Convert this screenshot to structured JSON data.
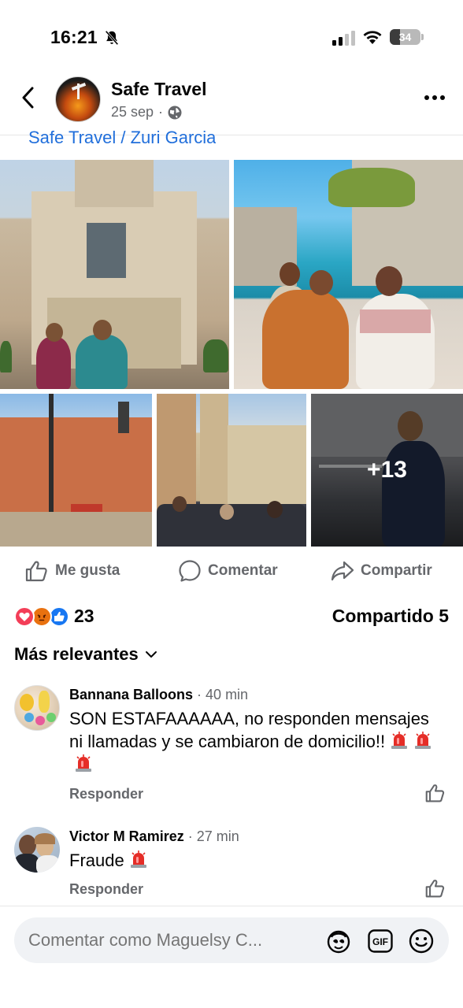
{
  "status_bar": {
    "time": "16:21",
    "battery_level": "34"
  },
  "header": {
    "page_name": "Safe Travel",
    "date": "25 sep",
    "dot": "·"
  },
  "caption": {
    "text": "Safe Travel / Zuri Garcia"
  },
  "photos": {
    "more_count": "+13"
  },
  "actions": {
    "like": "Me gusta",
    "comment": "Comentar",
    "share": "Compartir"
  },
  "reactions": {
    "count": "23",
    "shares": "Compartido 5"
  },
  "sort": {
    "label": "Más relevantes"
  },
  "comments": [
    {
      "author": "Bannana Balloons",
      "time": "· 40 min",
      "text": "SON ESTAFAAAAAA, no responden mensajes ni llamadas y se cambiaron de domicilio!!",
      "reply": "Responder"
    },
    {
      "author": "Victor M Ramirez",
      "time": "· 27 min",
      "text": "Fraude",
      "reply": "Responder"
    }
  ],
  "composer": {
    "placeholder": "Comentar como Maguelsy C..."
  },
  "colors": {
    "accent": "#216fdb",
    "secondary_text": "#65676b",
    "love": "#f33e58",
    "angry": "#e9710f",
    "like": "#1877f2"
  }
}
